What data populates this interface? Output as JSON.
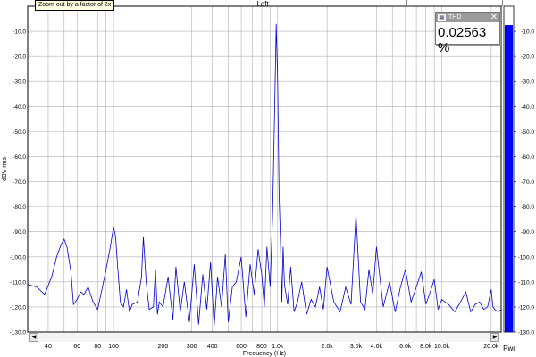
{
  "window": {
    "title": "Left",
    "tooltip": "Zoom out by a factor of 2x"
  },
  "thd_panel": {
    "label": "THD",
    "value": "0.02563 %",
    "close_glyph": "✕",
    "icon": "meter-icon"
  },
  "meter": {
    "label": "Pwr",
    "level_db": -7.5,
    "color": "#0000ff",
    "ticks": [
      "-10.0",
      "-20.0",
      "-30.0",
      "-40.0",
      "-50.0",
      "-60.0",
      "-70.0",
      "-80.0",
      "-90.0",
      "-100.0",
      "-110.0",
      "-120.0",
      "-130.0"
    ]
  },
  "scrollbar": {
    "left_glyph": "◀",
    "right_glyph": "▶"
  },
  "chart_data": {
    "type": "line",
    "title": "Left",
    "xlabel": "Frequency (Hz)",
    "ylabel": "dBV rms",
    "xscale": "log",
    "xlim": [
      30,
      23000
    ],
    "ylim": [
      -130,
      0
    ],
    "grid": true,
    "line_color": "#0000cc",
    "y_ticks": [
      -10,
      -20,
      -30,
      -40,
      -50,
      -60,
      -70,
      -80,
      -90,
      -100,
      -110,
      -120,
      -130
    ],
    "y_tick_labels": [
      "-10.0",
      "-20.0",
      "-30.0",
      "-40.0",
      "-50.0",
      "-60.0",
      "-70.0",
      "-80.0",
      "-90.0",
      "-100.0",
      "-110.0",
      "-120.0",
      "-130.0"
    ],
    "x_ticks": [
      40,
      60,
      80,
      100,
      200,
      300,
      400,
      600,
      800,
      1000,
      2000,
      3000,
      4000,
      6000,
      8000,
      10000,
      20000
    ],
    "x_tick_labels": [
      "40",
      "60",
      "80",
      "100",
      "200",
      "300",
      "400",
      "600",
      "800",
      "1.0k",
      "2.0k",
      "3.0k",
      "4.0k",
      "6.0k",
      "8.0k",
      "10.0k",
      "20.0k"
    ],
    "series": [
      {
        "x": [
          30,
          34,
          38,
          42,
          45,
          48,
          50,
          52,
          55,
          57,
          60,
          63,
          66,
          70,
          75,
          80,
          85,
          90,
          95,
          100,
          103,
          106,
          110,
          115,
          120,
          125,
          130,
          140,
          148,
          152,
          158,
          165,
          175,
          180,
          185,
          190,
          200,
          215,
          230,
          240,
          255,
          270,
          290,
          310,
          330,
          350,
          370,
          390,
          410,
          430,
          455,
          480,
          500,
          530,
          560,
          600,
          640,
          680,
          720,
          760,
          800,
          830,
          860,
          900,
          930,
          960,
          980,
          1000,
          1020,
          1040,
          1060,
          1080,
          1100,
          1150,
          1200,
          1260,
          1320,
          1400,
          1500,
          1600,
          1700,
          1800,
          1900,
          2000,
          2200,
          2400,
          2600,
          2800,
          3000,
          3200,
          3400,
          3600,
          3800,
          4000,
          4400,
          4800,
          5200,
          5600,
          6000,
          6500,
          7000,
          7500,
          8000,
          8500,
          9000,
          9500,
          10000,
          11000,
          12000,
          13000,
          14000,
          15000,
          16000,
          17000,
          18000,
          19000,
          20000,
          20500,
          21000,
          22000,
          23000
        ],
        "y": [
          -111,
          -112,
          -115,
          -108,
          -100,
          -95,
          -93,
          -96,
          -106,
          -119,
          -117,
          -114,
          -115,
          -112,
          -118,
          -121,
          -113,
          -105,
          -97,
          -88,
          -92,
          -104,
          -118,
          -120,
          -113,
          -122,
          -119,
          -118,
          -108,
          -92,
          -110,
          -121,
          -120,
          -105,
          -123,
          -118,
          -120,
          -108,
          -125,
          -104,
          -122,
          -110,
          -126,
          -103,
          -127,
          -107,
          -121,
          -102,
          -128,
          -108,
          -120,
          -99,
          -126,
          -112,
          -110,
          -100,
          -124,
          -103,
          -115,
          -97,
          -107,
          -120,
          -96,
          -112,
          -85,
          -40,
          -7,
          -30,
          -75,
          -93,
          -118,
          -96,
          -111,
          -119,
          -104,
          -122,
          -118,
          -110,
          -123,
          -117,
          -120,
          -112,
          -121,
          -104,
          -118,
          -122,
          -112,
          -119,
          -83,
          -118,
          -121,
          -105,
          -115,
          -96,
          -120,
          -110,
          -122,
          -112,
          -105,
          -118,
          -112,
          -106,
          -119,
          -114,
          -109,
          -121,
          -117,
          -119,
          -122,
          -118,
          -114,
          -122,
          -119,
          -118,
          -121,
          -120,
          -113,
          -120,
          -121,
          -122,
          -121
        ]
      }
    ]
  }
}
